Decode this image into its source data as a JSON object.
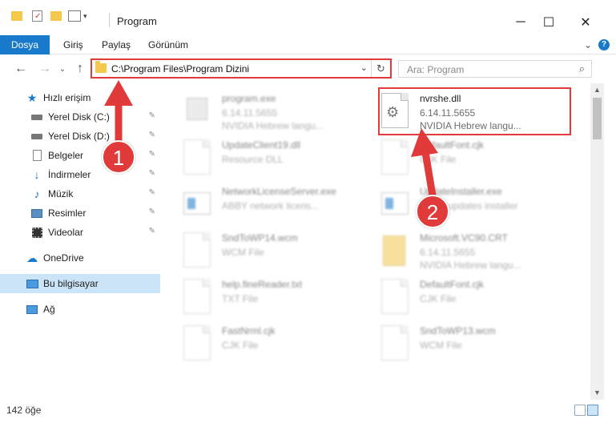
{
  "window": {
    "title": "Program",
    "minimize": "─",
    "maximize": "☐",
    "close": "✕"
  },
  "ribbon": {
    "tabs": [
      "Dosya",
      "Giriş",
      "Paylaş",
      "Görünüm"
    ],
    "expand": "⌄",
    "help": "?"
  },
  "nav": {
    "back": "←",
    "forward": "→",
    "recent": "⌄",
    "up": "↑",
    "address": "C:\\Program Files\\Program Dizini",
    "address_dropdown": "⌄",
    "refresh": "↻",
    "search_placeholder": "Ara: Program",
    "search_icon": "⌕"
  },
  "sidebar": {
    "items": [
      {
        "label": "Hızlı erişim",
        "icon": "star-icon",
        "pinned": false
      },
      {
        "label": "Yerel Disk (C:)",
        "icon": "drive-icon",
        "pinned": true
      },
      {
        "label": "Yerel Disk (D:)",
        "icon": "drive-icon",
        "pinned": true
      },
      {
        "label": "Belgeler",
        "icon": "documents-icon",
        "pinned": true
      },
      {
        "label": "İndirmeler",
        "icon": "downloads-icon",
        "pinned": true
      },
      {
        "label": "Müzik",
        "icon": "music-icon",
        "pinned": true
      },
      {
        "label": "Resimler",
        "icon": "pictures-icon",
        "pinned": true
      },
      {
        "label": "Videolar",
        "icon": "videos-icon",
        "pinned": true
      },
      {
        "label": "OneDrive",
        "icon": "cloud-icon",
        "pinned": false
      },
      {
        "label": "Bu bilgisayar",
        "icon": "computer-icon",
        "pinned": false
      },
      {
        "label": "Ağ",
        "icon": "network-icon",
        "pinned": false
      }
    ],
    "pin_glyph": "📌"
  },
  "files": {
    "left": [
      {
        "name": "program.exe",
        "sub1": "6.14.11.5655",
        "sub2": "NVIDIA Hebrew langu..."
      },
      {
        "name": "UpdateClient19.dll",
        "sub1": "Resource DLL",
        "sub2": ""
      },
      {
        "name": "NetworkLicenseServer.exe",
        "sub1": "ABBY network licens...",
        "sub2": ""
      },
      {
        "name": "SndToWP14.wcm",
        "sub1": "WCM File",
        "sub2": ""
      },
      {
        "name": "help.fineReader.txt",
        "sub1": "TXT File",
        "sub2": ""
      },
      {
        "name": "FastNrml.cjk",
        "sub1": "CJK File",
        "sub2": ""
      }
    ],
    "right": [
      {
        "name": "nvrshe.dll",
        "sub1": "6.14.11.5655",
        "sub2": "NVIDIA Hebrew langu..."
      },
      {
        "name": "DefaultFont.cjk",
        "sub1": "CJK File",
        "sub2": ""
      },
      {
        "name": "UpdateInstaller.exe",
        "sub1": "ABBY updates installer",
        "sub2": ""
      },
      {
        "name": "Microsoft.VC90.CRT",
        "sub1": "6.14.11.5655",
        "sub2": "NVIDIA Hebrew langu..."
      },
      {
        "name": "DefaultFont.cjk",
        "sub1": "CJK File",
        "sub2": ""
      },
      {
        "name": "SndToWP13.wcm",
        "sub1": "WCM File",
        "sub2": ""
      }
    ]
  },
  "status": {
    "count": "142 öğe"
  },
  "annotations": {
    "badge1": "1",
    "badge2": "2",
    "color": "#e03a3a"
  }
}
